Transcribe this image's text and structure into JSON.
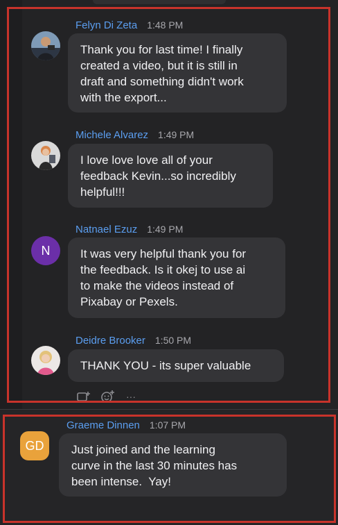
{
  "messages": [
    {
      "name": "Felyn Di Zeta",
      "time": "1:48 PM",
      "lines": [
        "Thank you for last time! I finally",
        "created a video, but it is still in",
        "draft and something didn't work",
        "with the export..."
      ]
    },
    {
      "name": "Michele Alvarez",
      "time": "1:49 PM",
      "lines": [
        "I love love love all of your",
        "feedback Kevin...so incredibly",
        "helpful!!!"
      ]
    },
    {
      "name": "Natnael Ezuz",
      "time": "1:49 PM",
      "avatar_letter": "N",
      "lines": [
        "It was very helpful thank you for",
        "the feedback. Is it okej to use ai",
        "to make the videos instead of",
        "Pixabay or Pexels."
      ]
    },
    {
      "name": "Deidre Brooker",
      "time": "1:50 PM",
      "lines": [
        "THANK YOU - its super valuable"
      ]
    }
  ],
  "reactions": {
    "add_reaction_icon": "add-reaction-icon",
    "emoji_icon": "emoji-icon",
    "more_label": "···"
  },
  "lower_message": {
    "name": "Graeme Dinnen",
    "time": "1:07 PM",
    "avatar_letter": "GD",
    "lines": [
      "Just joined and the learning",
      "curve in the last 30 minutes has",
      "been intense.  Yay!"
    ]
  },
  "colors": {
    "name": "#5b9ef0",
    "bubble": "#343437",
    "highlight": "#c8332b",
    "background": "#232325"
  }
}
